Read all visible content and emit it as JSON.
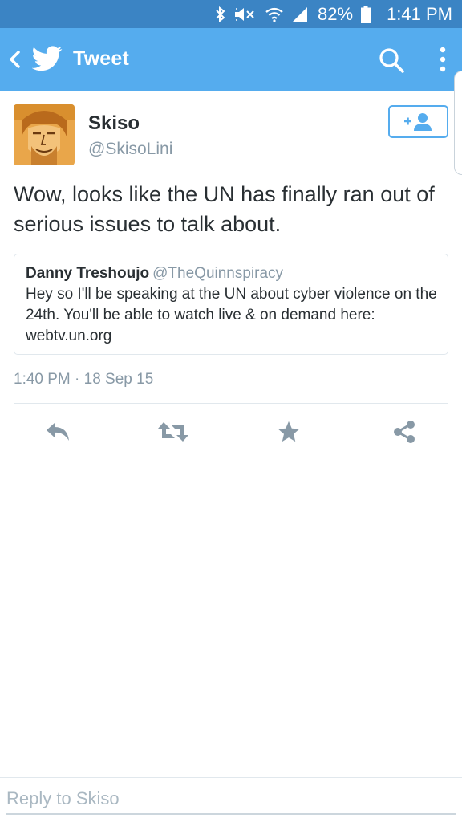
{
  "status_bar": {
    "battery": "82%",
    "time": "1:41 PM"
  },
  "app_bar": {
    "title": "Tweet"
  },
  "tweet": {
    "display_name": "Skiso",
    "screen_name": "@SkisoLini",
    "text": "Wow, looks like the UN has finally ran out of serious issues to talk about.",
    "timestamp": "1:40 PM · 18 Sep 15"
  },
  "quoted_tweet": {
    "display_name": "Danny Treshoujo",
    "screen_name": "@TheQuinnspiracy",
    "text": "Hey so I'll be speaking at the UN about cyber violence on the 24th. You'll be able to watch live & on demand here: webtv.un.org"
  },
  "actions": [
    "reply-icon",
    "retweet-icon",
    "favorite-star-icon",
    "share-icon"
  ],
  "reply": {
    "placeholder": "Reply to Skiso"
  },
  "colors": {
    "status_bar": "#3b84c4",
    "app_bar": "#55acee",
    "text": "#292f33",
    "muted": "#8899a6",
    "action_icon": "#8899a6"
  }
}
